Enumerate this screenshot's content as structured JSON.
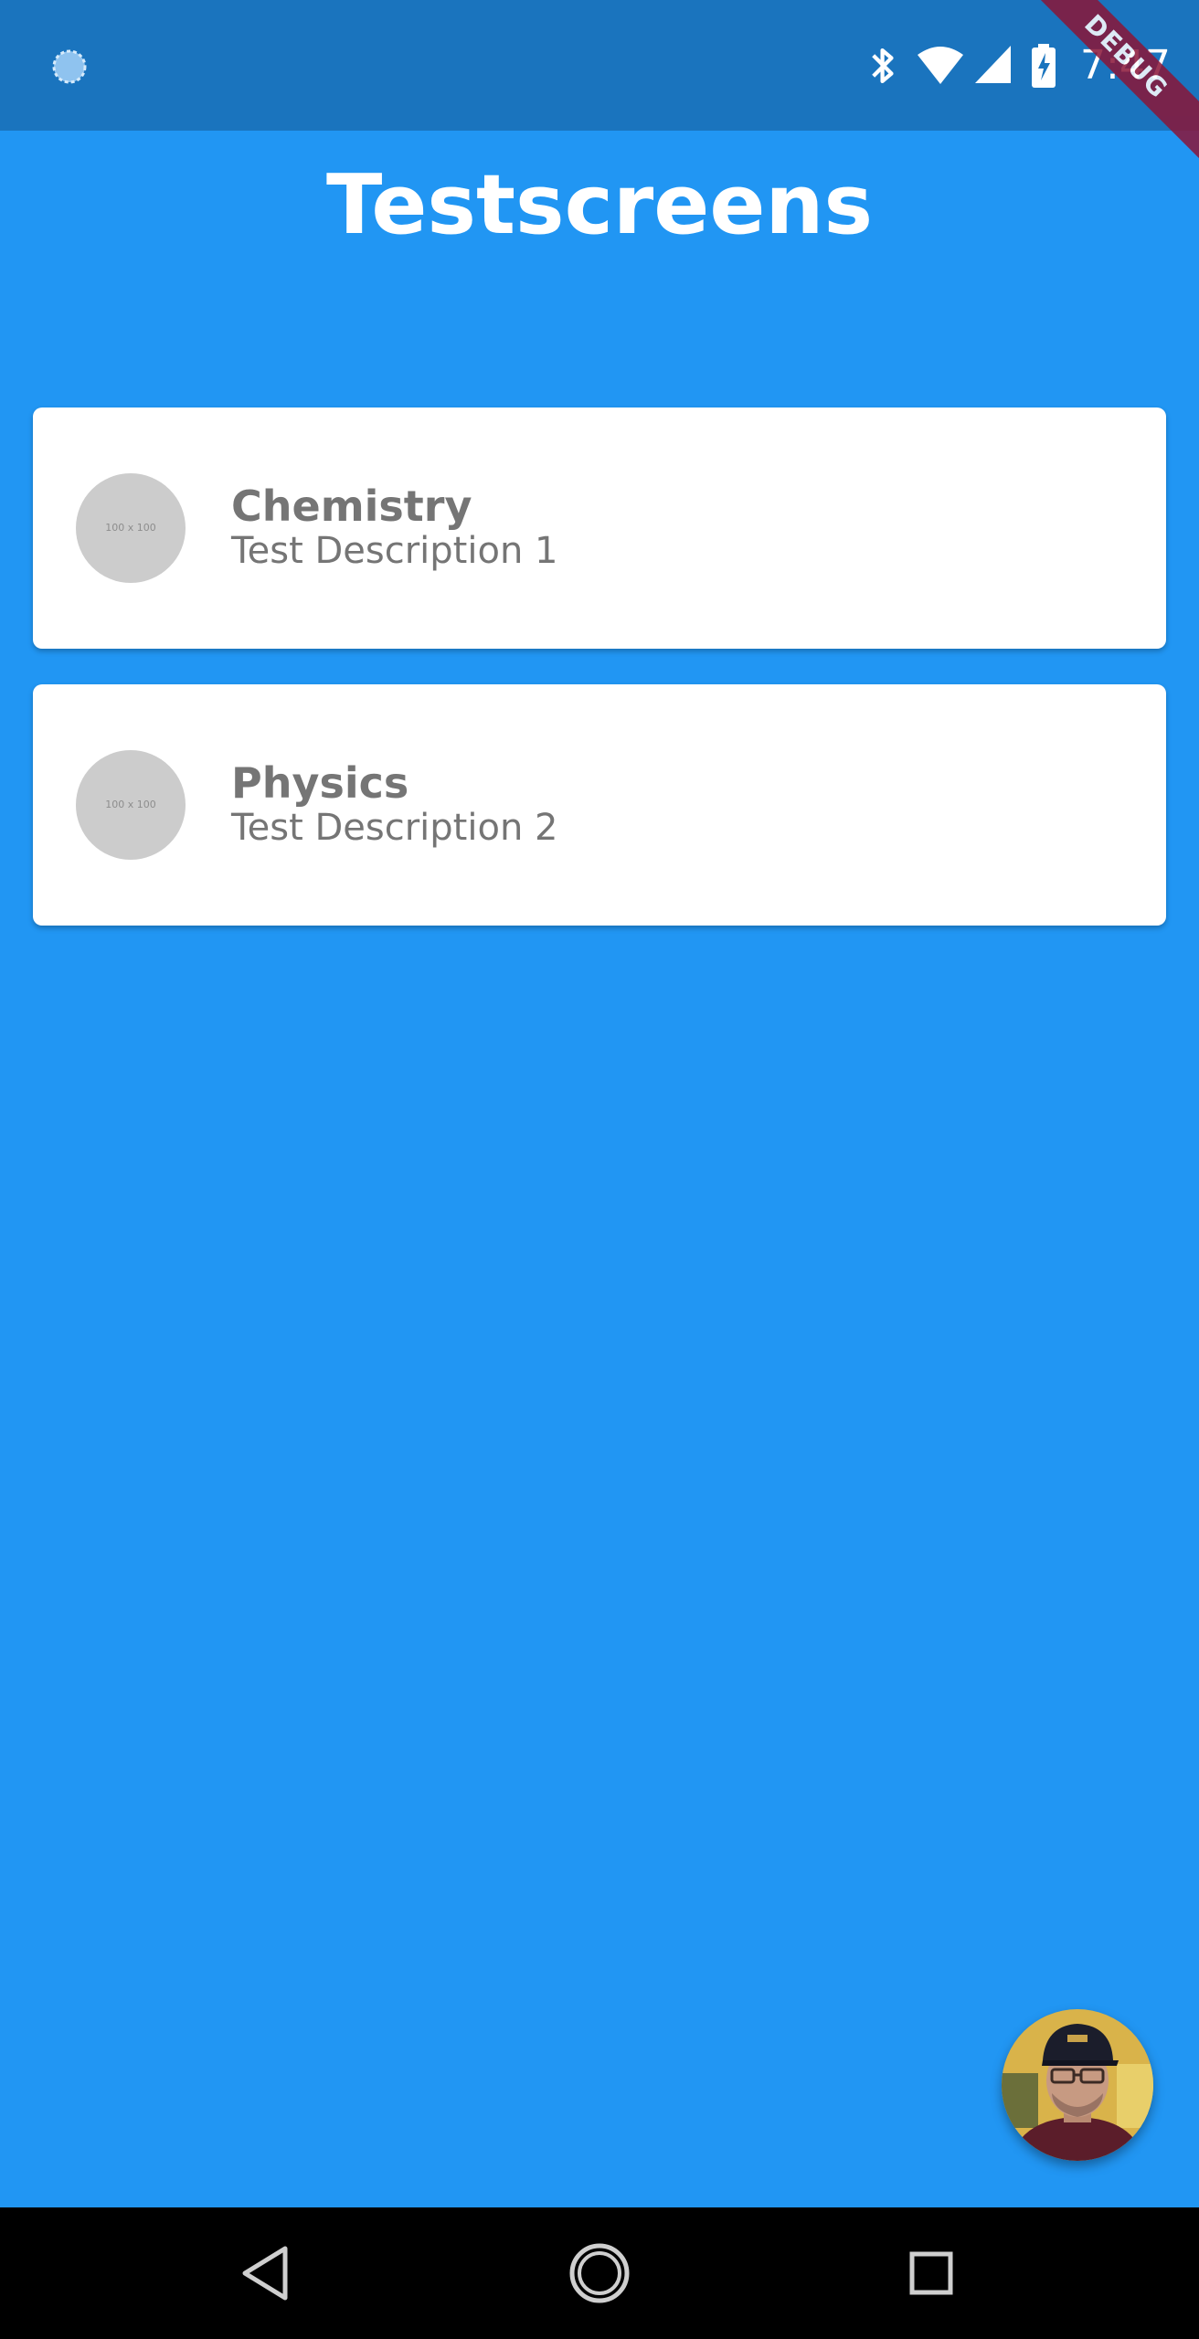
{
  "status_bar": {
    "time": "7:47",
    "debug_label": "DEBUG",
    "icons": [
      "loading-spinner-icon",
      "bluetooth-icon",
      "wifi-icon",
      "signal-icon",
      "battery-charging-icon"
    ]
  },
  "header": {
    "title": "Testscreens"
  },
  "cards": [
    {
      "title": "Chemistry",
      "description": "Test Description 1",
      "avatar_placeholder": "100 x 100"
    },
    {
      "title": "Physics",
      "description": "Test Description 2",
      "avatar_placeholder": "100 x 100"
    }
  ],
  "fab": {
    "icon": "user-avatar-photo"
  },
  "nav": {
    "icons": [
      "back-triangle-icon",
      "home-circle-icon",
      "recents-square-icon"
    ]
  },
  "colors": {
    "background": "#2196F3",
    "status_bar": "#1a74be",
    "card": "#ffffff",
    "card_text": "#757575",
    "avatar_placeholder": "#cccccc",
    "debug_banner": "#8a1538",
    "nav_bar": "#000000"
  }
}
